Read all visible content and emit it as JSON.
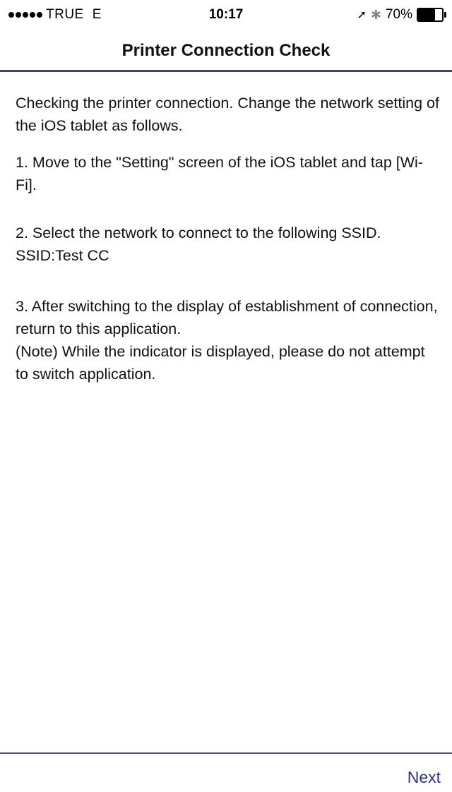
{
  "status_bar": {
    "carrier": "TRUE",
    "network_type": "E",
    "time": "10:17",
    "location_icon": "location-arrow-icon",
    "bluetooth_icon": "bluetooth-icon",
    "battery_percent": "70%",
    "battery_level": 0.7
  },
  "nav": {
    "title": "Printer Connection Check"
  },
  "content": {
    "intro": "Checking the printer connection. Change the network setting of the iOS tablet as follows.",
    "step1": "1. Move to the \"Setting\" screen of the iOS tablet and tap [Wi-Fi].",
    "step2": "2. Select the network to connect to the following SSID.\nSSID:Test CC",
    "step3": "3. After switching to the display of establishment of connection, return to this application.\n(Note) While the indicator is displayed, please do not attempt to switch application."
  },
  "footer": {
    "next_label": "Next"
  },
  "colors": {
    "accent": "#2f3487",
    "divider": "#3a3e8c"
  }
}
